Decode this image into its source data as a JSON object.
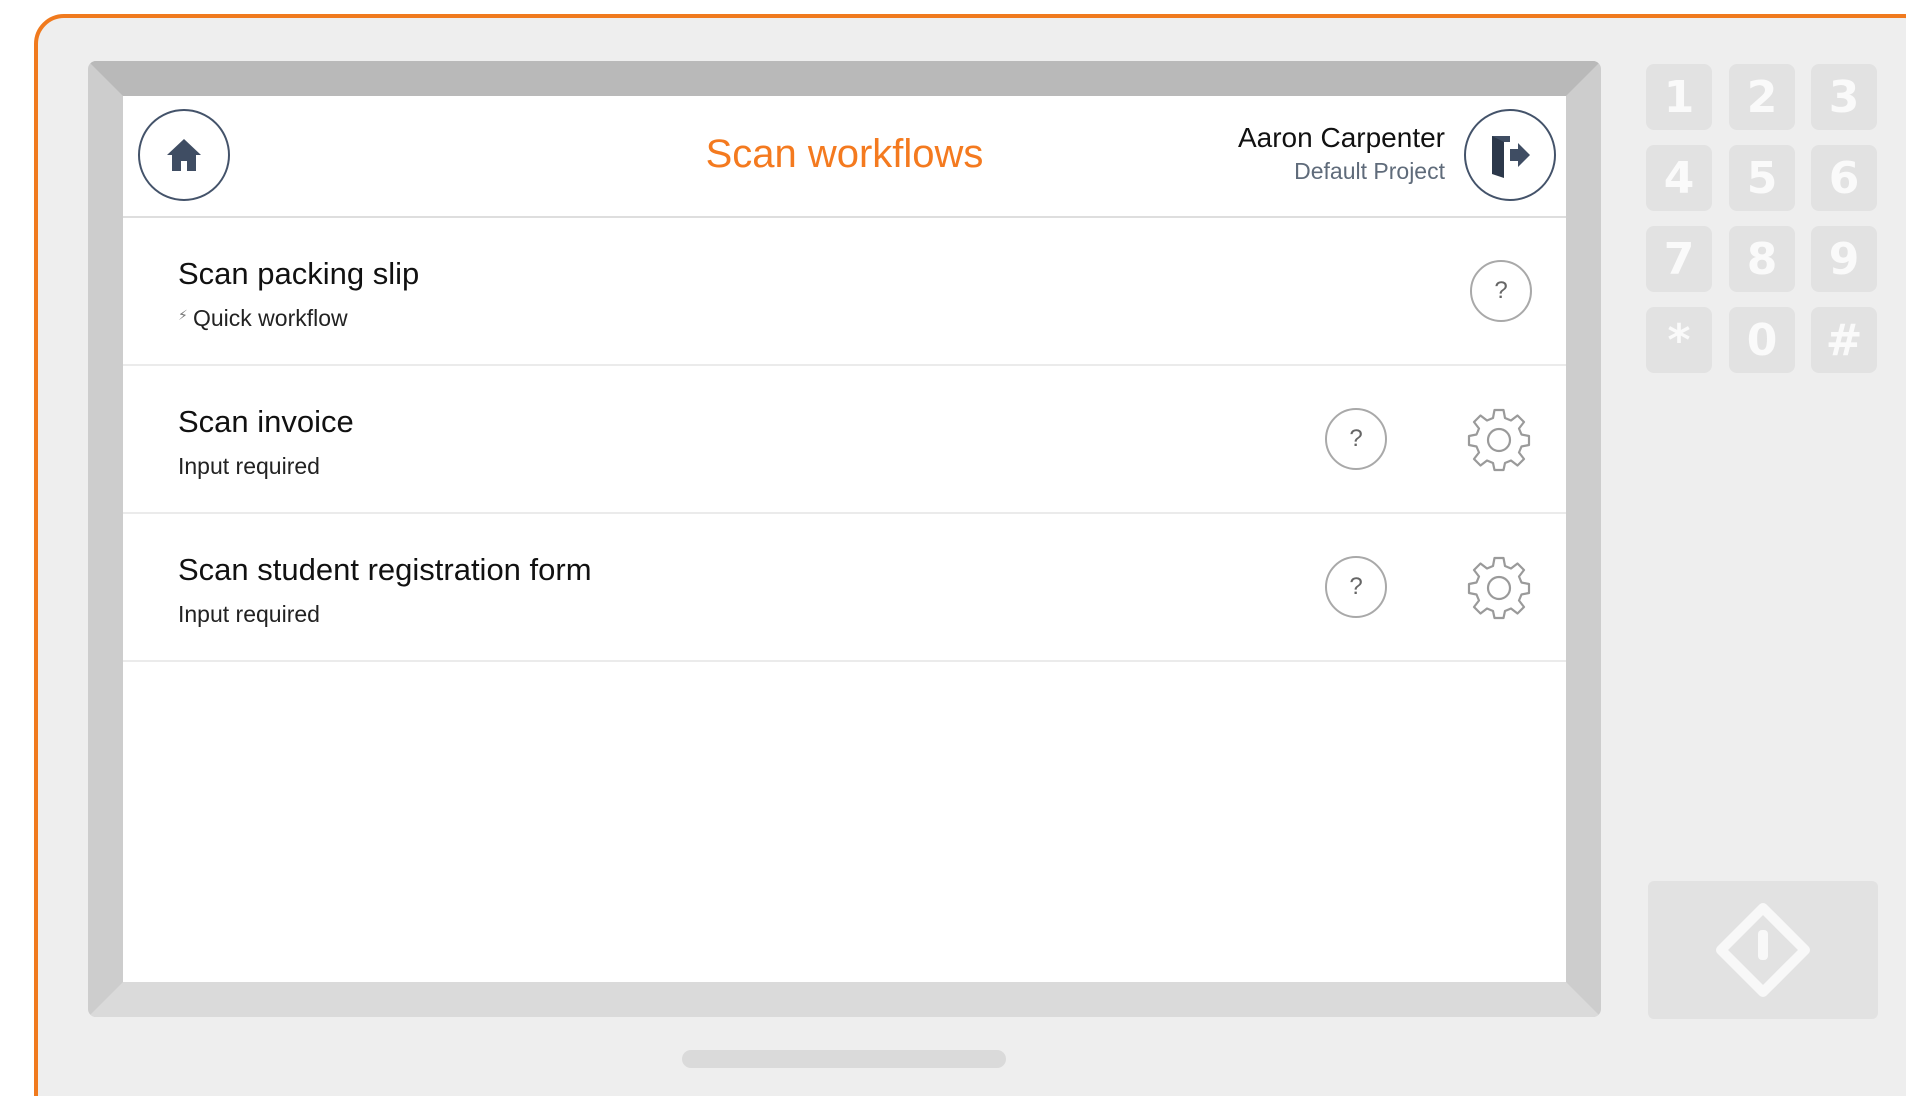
{
  "header": {
    "title": "Scan workflows",
    "user_name": "Aaron Carpenter",
    "project": "Default Project"
  },
  "icons": {
    "home": "home-icon",
    "logout": "logout-icon",
    "help": "help-icon",
    "settings": "gear-icon",
    "quick": "lightning-bolt-icon",
    "start": "start-icon"
  },
  "colors": {
    "accent": "#f47a1f",
    "icon_dark": "#44536a"
  },
  "workflows": [
    {
      "title": "Scan packing slip",
      "subtitle": "Quick workflow",
      "quick": true,
      "has_settings": false
    },
    {
      "title": "Scan invoice",
      "subtitle": "Input required",
      "quick": false,
      "has_settings": true
    },
    {
      "title": "Scan student registration form",
      "subtitle": "Input required",
      "quick": false,
      "has_settings": true
    }
  ],
  "help_label": "?",
  "keypad": {
    "keys": [
      "1",
      "2",
      "3",
      "4",
      "5",
      "6",
      "7",
      "8",
      "9",
      "*",
      "0",
      "#"
    ]
  }
}
